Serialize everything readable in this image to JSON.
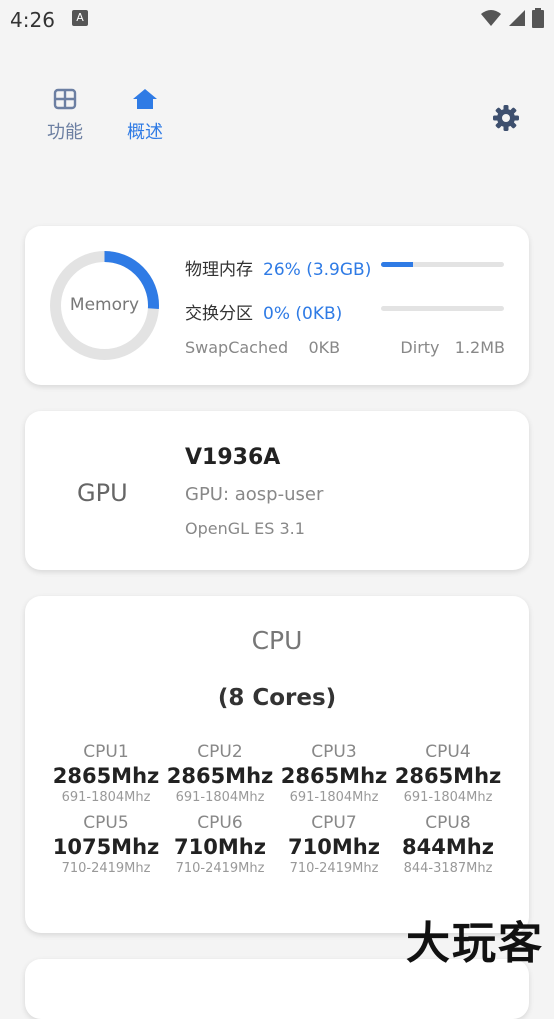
{
  "status_bar": {
    "time": "4:26",
    "notification_icon": "A"
  },
  "tabs": [
    {
      "label": "功能",
      "icon": "grid-icon",
      "active": false
    },
    {
      "label": "概述",
      "icon": "home-icon",
      "active": true
    }
  ],
  "memory": {
    "ring_label": "Memory",
    "physical": {
      "label": "物理内存",
      "value": "26% (3.9GB)",
      "percent": 26
    },
    "swap": {
      "label": "交换分区",
      "value": "0% (0KB)",
      "percent": 0
    },
    "swapcached": "SwapCached    0KB",
    "dirty": "Dirty   1.2MB"
  },
  "gpu": {
    "title": "GPU",
    "model": "V1936A",
    "renderer": "GPU: aosp-user",
    "opengl": "OpenGL ES 3.1"
  },
  "cpu": {
    "title": "CPU",
    "cores": "(8 Cores)",
    "items": [
      {
        "name": "CPU1",
        "freq": "2865Mhz",
        "range": "691-1804Mhz"
      },
      {
        "name": "CPU2",
        "freq": "2865Mhz",
        "range": "691-1804Mhz"
      },
      {
        "name": "CPU3",
        "freq": "2865Mhz",
        "range": "691-1804Mhz"
      },
      {
        "name": "CPU4",
        "freq": "2865Mhz",
        "range": "691-1804Mhz"
      },
      {
        "name": "CPU5",
        "freq": "1075Mhz",
        "range": "710-2419Mhz"
      },
      {
        "name": "CPU6",
        "freq": "710Mhz",
        "range": "710-2419Mhz"
      },
      {
        "name": "CPU7",
        "freq": "710Mhz",
        "range": "710-2419Mhz"
      },
      {
        "name": "CPU8",
        "freq": "844Mhz",
        "range": "844-3187Mhz"
      }
    ]
  },
  "watermark": "大玩客",
  "colors": {
    "accent": "#2f7be5",
    "track": "#e3e3e3"
  }
}
